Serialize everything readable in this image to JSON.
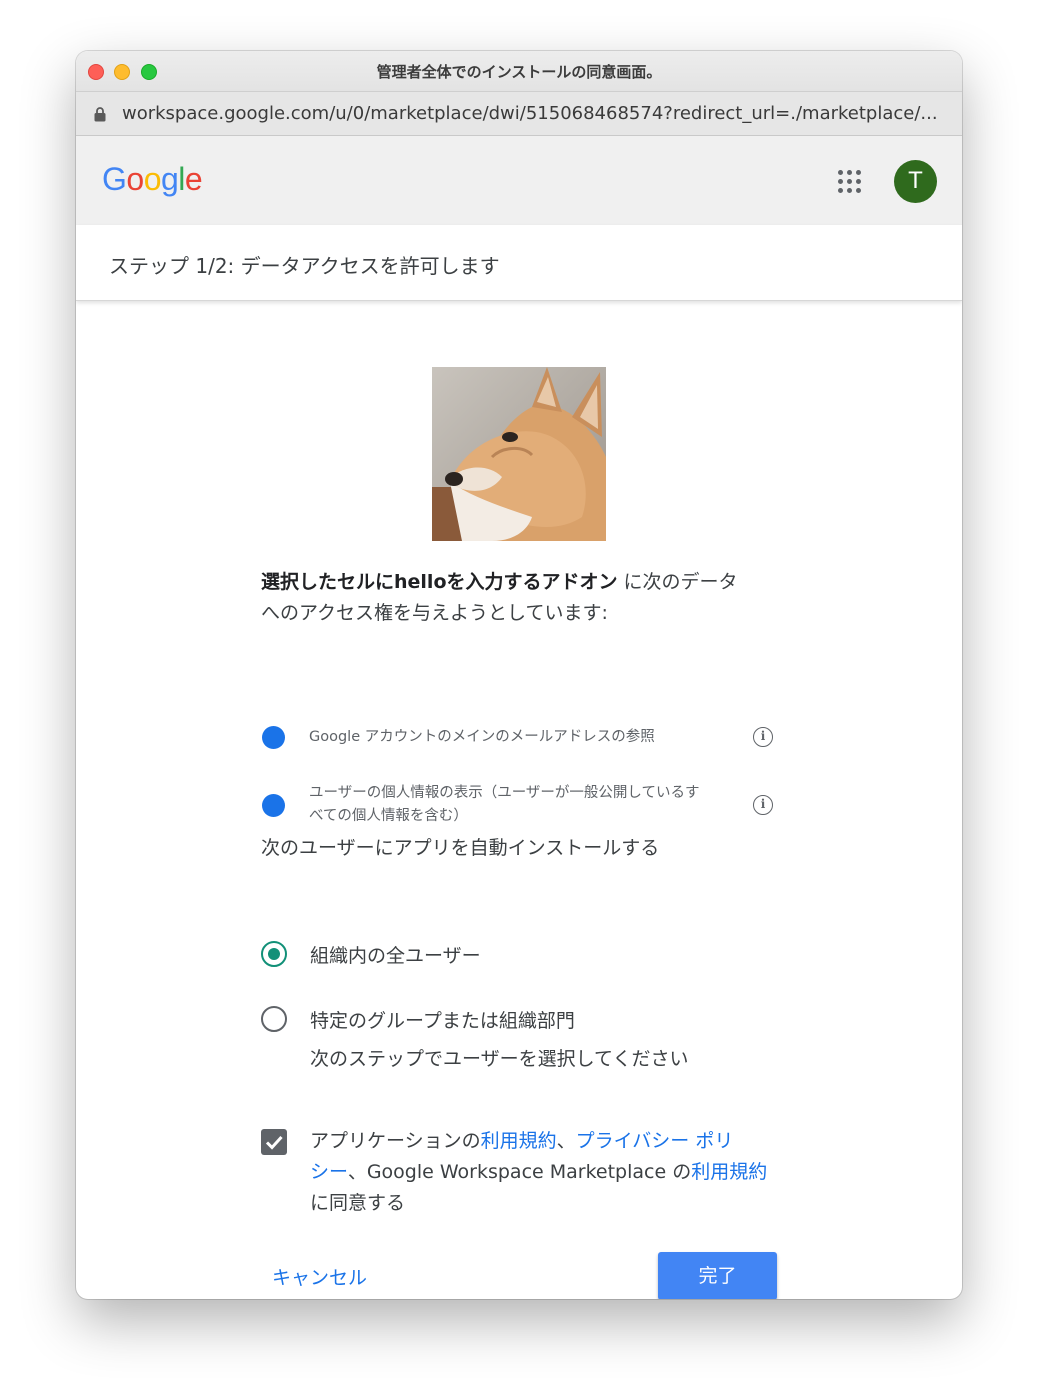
{
  "window": {
    "title": "管理者全体でのインストールの同意画面。",
    "url": "workspace.google.com/u/0/marketplace/dwi/515068468574?redirect_url=./marketplace/..."
  },
  "header": {
    "logo_letters": [
      "G",
      "o",
      "o",
      "g",
      "l",
      "e"
    ],
    "logo_colors": [
      "#4285F4",
      "#EA4335",
      "#FBBC05",
      "#4285F4",
      "#34A853",
      "#EA4335"
    ],
    "avatar_initial": "T",
    "avatar_color": "#2f6a1d"
  },
  "step": {
    "title": "ステップ 1/2: データアクセスを許可します"
  },
  "intro": {
    "app_name": "選択したセルにhelloを入力するアドオン",
    "line1_rest": " に次のデータ",
    "line2": "へのアクセス権を与えようとしています:"
  },
  "scopes": [
    {
      "line1": "Google アカウントのメインのメールアドレスの参照",
      "line2": ""
    },
    {
      "line1": "ユーザーの個人情報の表示（ユーザーが一般公開しているす",
      "line2": "べての個人情報を含む）"
    }
  ],
  "install": {
    "label": "次のユーザーにアプリを自動インストールする",
    "options": [
      {
        "label": "組織内の全ユーザー",
        "sub": "",
        "selected": true
      },
      {
        "label": "特定のグループまたは組織部門",
        "sub": "次のステップでユーザーを選択してください",
        "selected": false
      }
    ]
  },
  "terms": {
    "checked": true,
    "t1": "アプリケーションの",
    "link1": "利用規約",
    "t2": "、",
    "link2a": "プライバシー ポリ",
    "link2b": "シー",
    "t3": "、Google Workspace Marketplace の",
    "link3": "利用規約",
    "t4": "に同意する"
  },
  "buttons": {
    "cancel": "キャンセル",
    "done": "完了"
  },
  "colors": {
    "accent": "#1a73e8",
    "primary_button": "#4285f4",
    "radio_selected": "#129078"
  }
}
